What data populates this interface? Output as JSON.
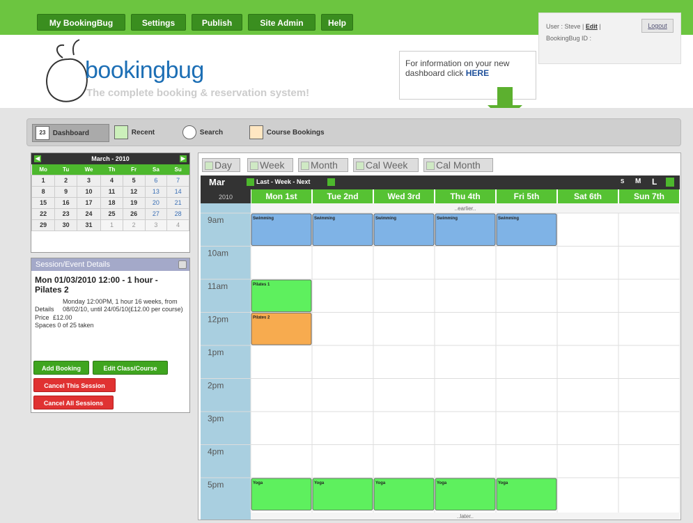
{
  "nav": {
    "items": [
      "My BookingBug",
      "Settings",
      "Publish",
      "Site Admin",
      "Help"
    ]
  },
  "user": {
    "prefix": "User : Steve |",
    "edit": "Edit",
    "sep": "|",
    "bb_id": "BookingBug ID :",
    "logout": "Logout"
  },
  "brand": {
    "name": "bookingbug",
    "tagline": "The complete booking & reservation system!"
  },
  "info": {
    "text": "For information on your new dashboard click",
    "link": "HERE"
  },
  "toolbar": {
    "dashboard": "Dashboard",
    "dashboard_icon": "23",
    "recent": "Recent",
    "search": "Search",
    "course": "Course Bookings"
  },
  "minical": {
    "title": "March - 2010",
    "days": [
      "Mo",
      "Tu",
      "We",
      "Th",
      "Fr",
      "Sa",
      "Su"
    ],
    "weeks": [
      [
        "1",
        "2",
        "3",
        "4",
        "5",
        "6",
        "7"
      ],
      [
        "8",
        "9",
        "10",
        "11",
        "12",
        "13",
        "14"
      ],
      [
        "15",
        "16",
        "17",
        "18",
        "19",
        "20",
        "21"
      ],
      [
        "22",
        "23",
        "24",
        "25",
        "26",
        "27",
        "28"
      ],
      [
        "29",
        "30",
        "31",
        "1",
        "2",
        "3",
        "4"
      ]
    ]
  },
  "details": {
    "header": "Session/Event Details",
    "title": "Mon 01/03/2010 12:00 - 1 hour - Pilates 2",
    "details_label": "Details",
    "details_value": "Monday 12:00PM, 1 hour 16 weeks, from 08/02/10, until 24/05/10(£12.00 per course)",
    "price_label": "Price",
    "price_value": "£12.00",
    "spaces": "Spaces 0 of 25 taken",
    "add_booking": "Add Booking",
    "edit_class": "Edit Class/Course",
    "cancel_session": "Cancel This Session",
    "cancel_all": "Cancel All Sessions"
  },
  "views": [
    "Day",
    "Week",
    "Month",
    "Cal Week",
    "Cal Month"
  ],
  "cal": {
    "month": "Mar",
    "year": "2010",
    "nav": "Last - Week - Next",
    "sizes": [
      "S",
      "M",
      "L"
    ],
    "earlier": "..earlier..",
    "later": "..later..",
    "days": [
      "Mon 1st",
      "Tue 2nd",
      "Wed 3rd",
      "Thu 4th",
      "Fri 5th",
      "Sat 6th",
      "Sun 7th"
    ],
    "hours": [
      "9am",
      "10am",
      "11am",
      "12pm",
      "1pm",
      "2pm",
      "3pm",
      "4pm",
      "5pm"
    ],
    "events": [
      {
        "day": 0,
        "hour": 0,
        "label": "Swimming",
        "color": "#7fb3e6"
      },
      {
        "day": 1,
        "hour": 0,
        "label": "Swimming",
        "color": "#7fb3e6"
      },
      {
        "day": 2,
        "hour": 0,
        "label": "Swimming",
        "color": "#7fb3e6"
      },
      {
        "day": 3,
        "hour": 0,
        "label": "Swimming",
        "color": "#7fb3e6"
      },
      {
        "day": 4,
        "hour": 0,
        "label": "Swimming",
        "color": "#7fb3e6"
      },
      {
        "day": 0,
        "hour": 2,
        "label": "Pilates 1",
        "color": "#5ef05e"
      },
      {
        "day": 0,
        "hour": 3,
        "label": "Pilates 2",
        "color": "#f7ab4f"
      },
      {
        "day": 0,
        "hour": 8,
        "label": "Yoga",
        "color": "#5ef05e"
      },
      {
        "day": 1,
        "hour": 8,
        "label": "Yoga",
        "color": "#5ef05e"
      },
      {
        "day": 2,
        "hour": 8,
        "label": "Yoga",
        "color": "#5ef05e"
      },
      {
        "day": 3,
        "hour": 8,
        "label": "Yoga",
        "color": "#5ef05e"
      },
      {
        "day": 4,
        "hour": 8,
        "label": "Yoga",
        "color": "#5ef05e"
      }
    ]
  }
}
